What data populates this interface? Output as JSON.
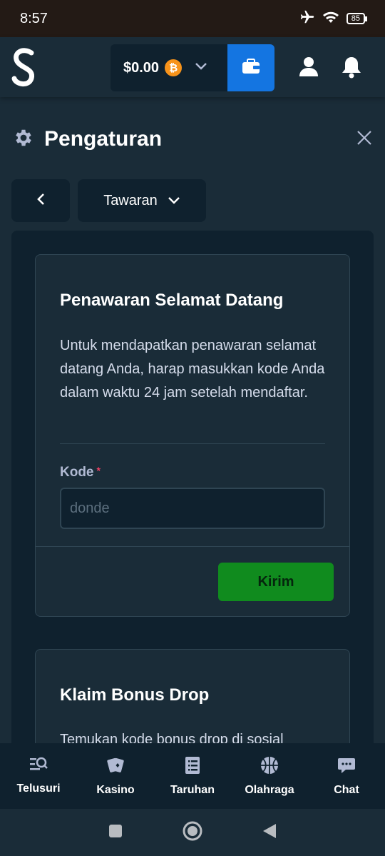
{
  "status_bar": {
    "time": "8:57",
    "battery": "85"
  },
  "header": {
    "balance": "$0.00",
    "currency_icon": "bitcoin-icon",
    "currency_symbol": "₿",
    "accent": "#1475e1"
  },
  "page": {
    "title": "Pengaturan",
    "dropdown_label": "Tawaran"
  },
  "welcome_offer": {
    "title": "Penawaran Selamat Datang",
    "description": "Untuk mendapatkan penawaran selamat datang Anda, harap masukkan kode Anda dalam waktu 24 jam setelah mendaftar.",
    "code_label": "Kode",
    "required_mark": "*",
    "code_value": "",
    "code_placeholder": "donde",
    "submit_label": "Kirim",
    "submit_color": "#108b1e"
  },
  "bonus_drop": {
    "title": "Klaim Bonus Drop",
    "description": "Temukan kode bonus drop di sosial"
  },
  "bottom_nav": [
    {
      "label": "Telusuri",
      "icon": "search-list-icon"
    },
    {
      "label": "Kasino",
      "icon": "cards-icon"
    },
    {
      "label": "Taruhan",
      "icon": "betslip-icon"
    },
    {
      "label": "Olahraga",
      "icon": "basketball-icon"
    },
    {
      "label": "Chat",
      "icon": "chat-icon"
    }
  ]
}
